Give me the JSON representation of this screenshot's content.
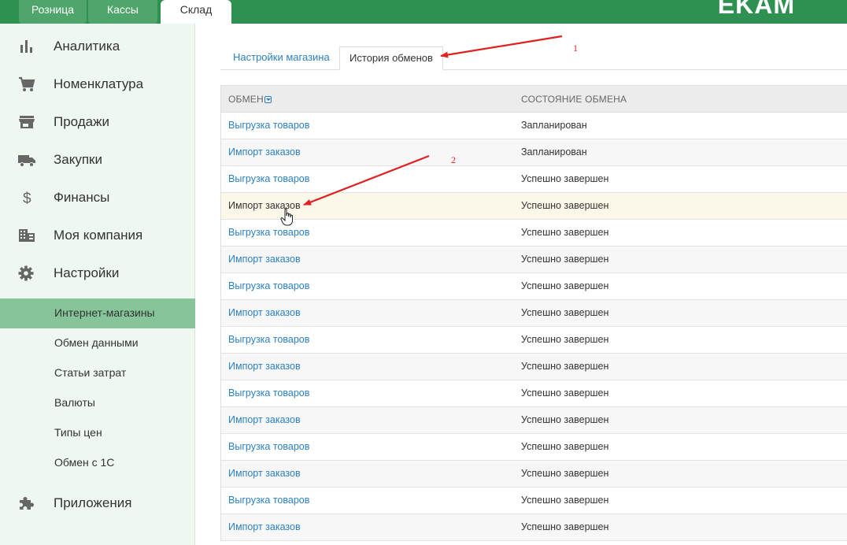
{
  "topbar": {
    "tabs": [
      "Розница",
      "Кассы",
      "Склад"
    ],
    "active_tab": "Склад",
    "brand": "EKAM"
  },
  "sidebar": {
    "items": [
      {
        "label": "Аналитика",
        "icon": "bar-chart-icon"
      },
      {
        "label": "Номенклатура",
        "icon": "cart-icon"
      },
      {
        "label": "Продажи",
        "icon": "store-icon"
      },
      {
        "label": "Закупки",
        "icon": "truck-icon"
      },
      {
        "label": "Финансы",
        "icon": "dollar-icon"
      },
      {
        "label": "Моя компания",
        "icon": "building-icon"
      },
      {
        "label": "Настройки",
        "icon": "gear-icon"
      }
    ],
    "subitems": [
      {
        "label": "Интернет-магазины",
        "active": true
      },
      {
        "label": "Обмен данными"
      },
      {
        "label": "Статьи затрат"
      },
      {
        "label": "Валюты"
      },
      {
        "label": "Типы цен"
      },
      {
        "label": "Обмен с 1С"
      }
    ],
    "apps": {
      "label": "Приложения",
      "icon": "puzzle-icon"
    }
  },
  "main": {
    "tabs": [
      "Настройки магазина",
      "История обменов"
    ],
    "active_tab": "История обменов",
    "table": {
      "headers": [
        "ОБМЕН",
        "СОСТОЯНИЕ ОБМЕНА"
      ],
      "rows": [
        [
          "Выгрузка товаров",
          "Запланирован"
        ],
        [
          "Импорт заказов",
          "Запланирован"
        ],
        [
          "Выгрузка товаров",
          "Успешно завершен"
        ],
        [
          "Импорт заказов",
          "Успешно завершен"
        ],
        [
          "Выгрузка товаров",
          "Успешно завершен"
        ],
        [
          "Импорт заказов",
          "Успешно завершен"
        ],
        [
          "Выгрузка товаров",
          "Успешно завершен"
        ],
        [
          "Импорт заказов",
          "Успешно завершен"
        ],
        [
          "Выгрузка товаров",
          "Успешно завершен"
        ],
        [
          "Импорт заказов",
          "Успешно завершен"
        ],
        [
          "Выгрузка товаров",
          "Успешно завершен"
        ],
        [
          "Импорт заказов",
          "Успешно завершен"
        ],
        [
          "Выгрузка товаров",
          "Успешно завершен"
        ],
        [
          "Импорт заказов",
          "Успешно завершен"
        ],
        [
          "Выгрузка товаров",
          "Успешно завершен"
        ],
        [
          "Импорт заказов",
          "Успешно завершен"
        ]
      ],
      "highlighted_row": 3
    }
  },
  "annotations": {
    "label_1": "1",
    "label_2": "2",
    "color": "#e02020"
  },
  "colors": {
    "topbar": "#2f9151",
    "sidebar_bg": "#eef7f0",
    "sidebar_active": "#86c49a",
    "link": "#2a7fc1"
  }
}
